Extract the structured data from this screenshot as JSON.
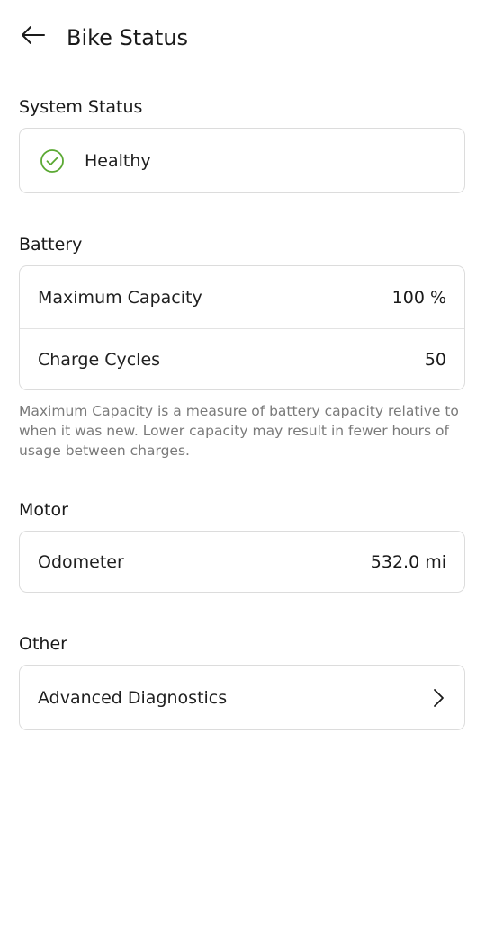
{
  "header": {
    "title": "Bike Status",
    "back_icon": "arrow-left-icon"
  },
  "system_status": {
    "title": "System Status",
    "status_label": "Healthy",
    "status_icon": "check-circle-icon",
    "status_color": "#5aa832"
  },
  "battery": {
    "title": "Battery",
    "rows": [
      {
        "label": "Maximum Capacity",
        "value": "100 %"
      },
      {
        "label": "Charge Cycles",
        "value": "50"
      }
    ],
    "note": "Maximum Capacity is a measure of battery capacity relative to when it was new. Lower capacity may result in fewer hours of usage between charges."
  },
  "motor": {
    "title": "Motor",
    "rows": [
      {
        "label": "Odometer",
        "value": "532.0 mi"
      }
    ]
  },
  "other": {
    "title": "Other",
    "rows": [
      {
        "label": "Advanced Diagnostics",
        "icon": "chevron-right-icon"
      }
    ]
  }
}
